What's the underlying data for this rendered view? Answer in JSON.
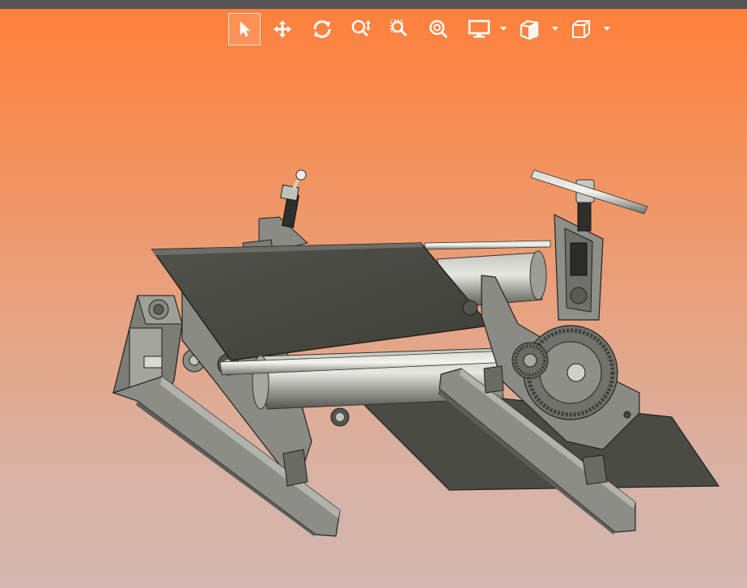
{
  "app": {
    "background_colors": [
      "#ff7f3a",
      "#d4b7b1"
    ],
    "top_strip_color": "#545454"
  },
  "toolbar": {
    "items": [
      {
        "icon": "select-pointer-icon",
        "active": true
      },
      {
        "icon": "pan-move-icon",
        "active": false
      },
      {
        "icon": "rotate-icon",
        "active": false
      },
      {
        "icon": "zoom-in-out-icon",
        "active": false
      },
      {
        "icon": "zoom-window-icon",
        "active": false
      },
      {
        "icon": "zoom-fit-icon",
        "active": false
      },
      {
        "icon": "display-mode-icon",
        "dropdown": true
      },
      {
        "icon": "section-view-icon",
        "dropdown": true
      },
      {
        "icon": "view-orientation-cube-icon",
        "dropdown": true
      }
    ]
  },
  "model": {
    "subject": "press-roller-machine-assembly",
    "colors": {
      "plate": "#4b4c46",
      "metal": "#8e8f88",
      "highlight": "#c9cac3",
      "dark": "#2f302c"
    }
  }
}
